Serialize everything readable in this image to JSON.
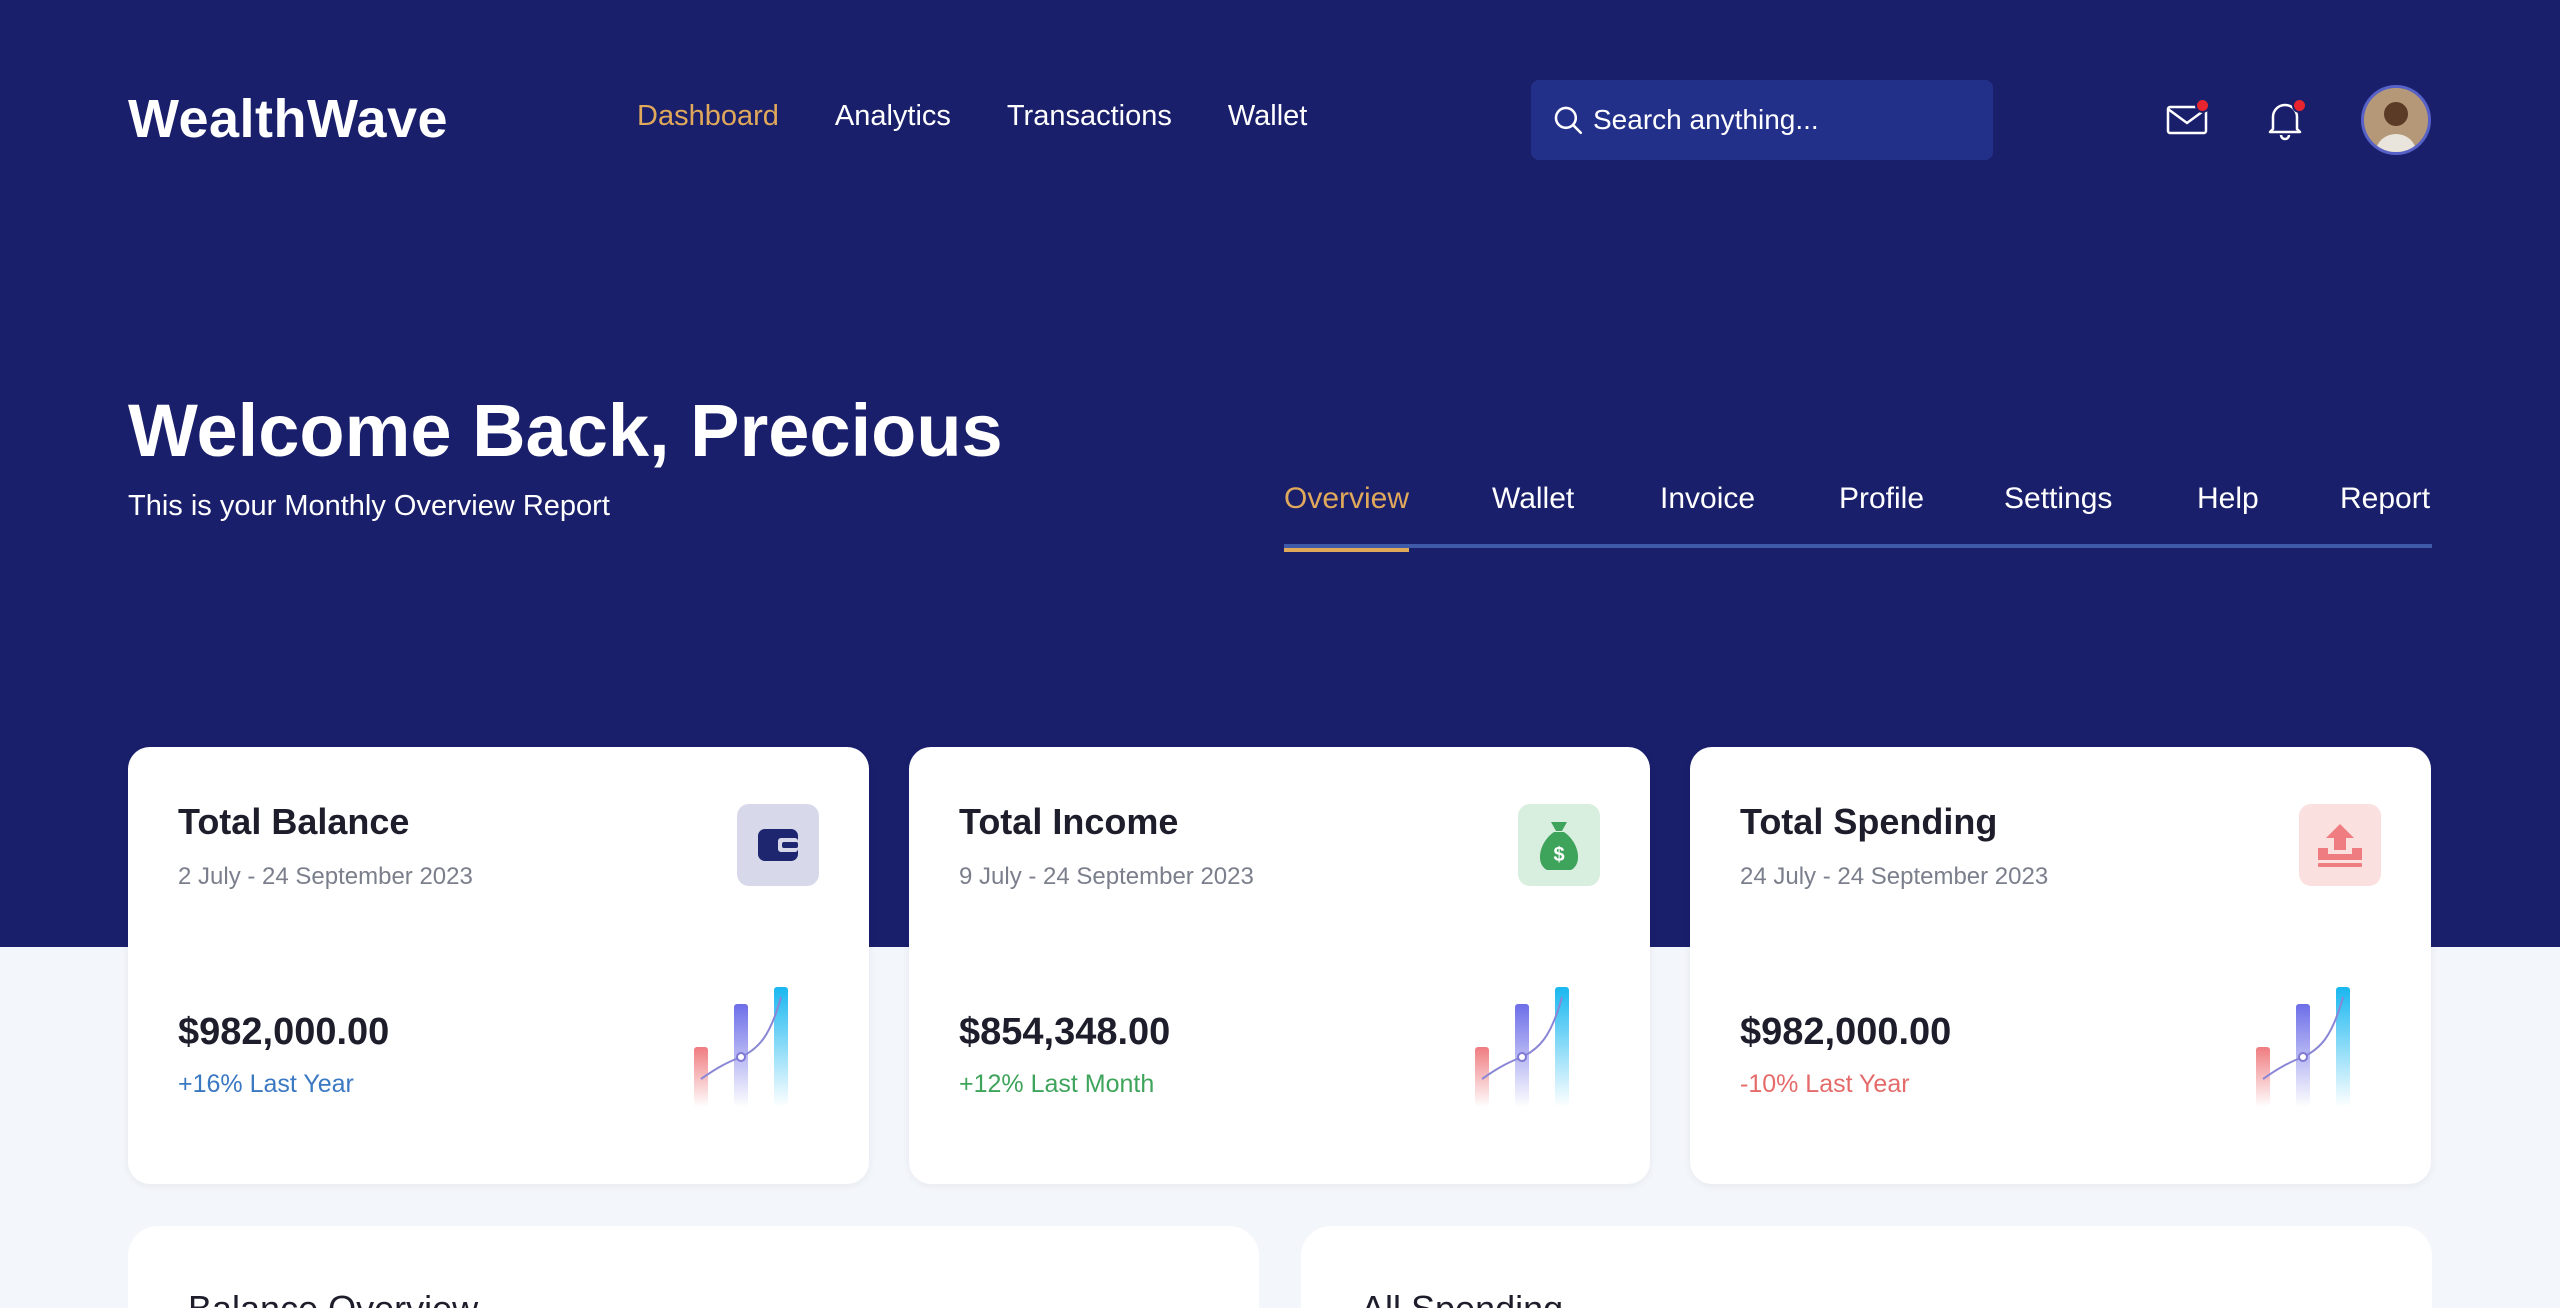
{
  "app": {
    "name": "WealthWave"
  },
  "nav": {
    "items": [
      "Dashboard",
      "Analytics",
      "Transactions",
      "Wallet"
    ],
    "active": "Dashboard"
  },
  "search": {
    "placeholder": "Search anything..."
  },
  "header_icons": [
    "mail-icon",
    "bell-icon"
  ],
  "welcome": {
    "title": "Welcome Back, Precious",
    "subtitle": "This is your Monthly Overview Report"
  },
  "tabs": {
    "items": [
      "Overview",
      "Wallet",
      "Invoice",
      "Profile",
      "Settings",
      "Help",
      "Report"
    ],
    "active": "Overview"
  },
  "cards": [
    {
      "title": "Total Balance",
      "date": "2 July - 24 September 2023",
      "amount": "$982,000.00",
      "change": "+16% Last Year",
      "icon": "wallet-icon"
    },
    {
      "title": "Total Income",
      "date": "9 July - 24 September 2023",
      "amount": "$854,348.00",
      "change": "+12% Last Month",
      "icon": "money-bag-icon"
    },
    {
      "title": "Total Spending",
      "date": "24 July - 24 September 2023",
      "amount": "$982,000.00",
      "change": "-10% Last Year",
      "icon": "upload-tray-icon"
    }
  ],
  "panels": {
    "left_title": "Balance Overview",
    "right_title": "All Spending"
  },
  "colors": {
    "hero_bg": "#1a1f6b",
    "accent": "#e0a85a",
    "positive_blue": "#3a78c2",
    "positive_green": "#3fa45b",
    "negative": "#e56b6b"
  }
}
